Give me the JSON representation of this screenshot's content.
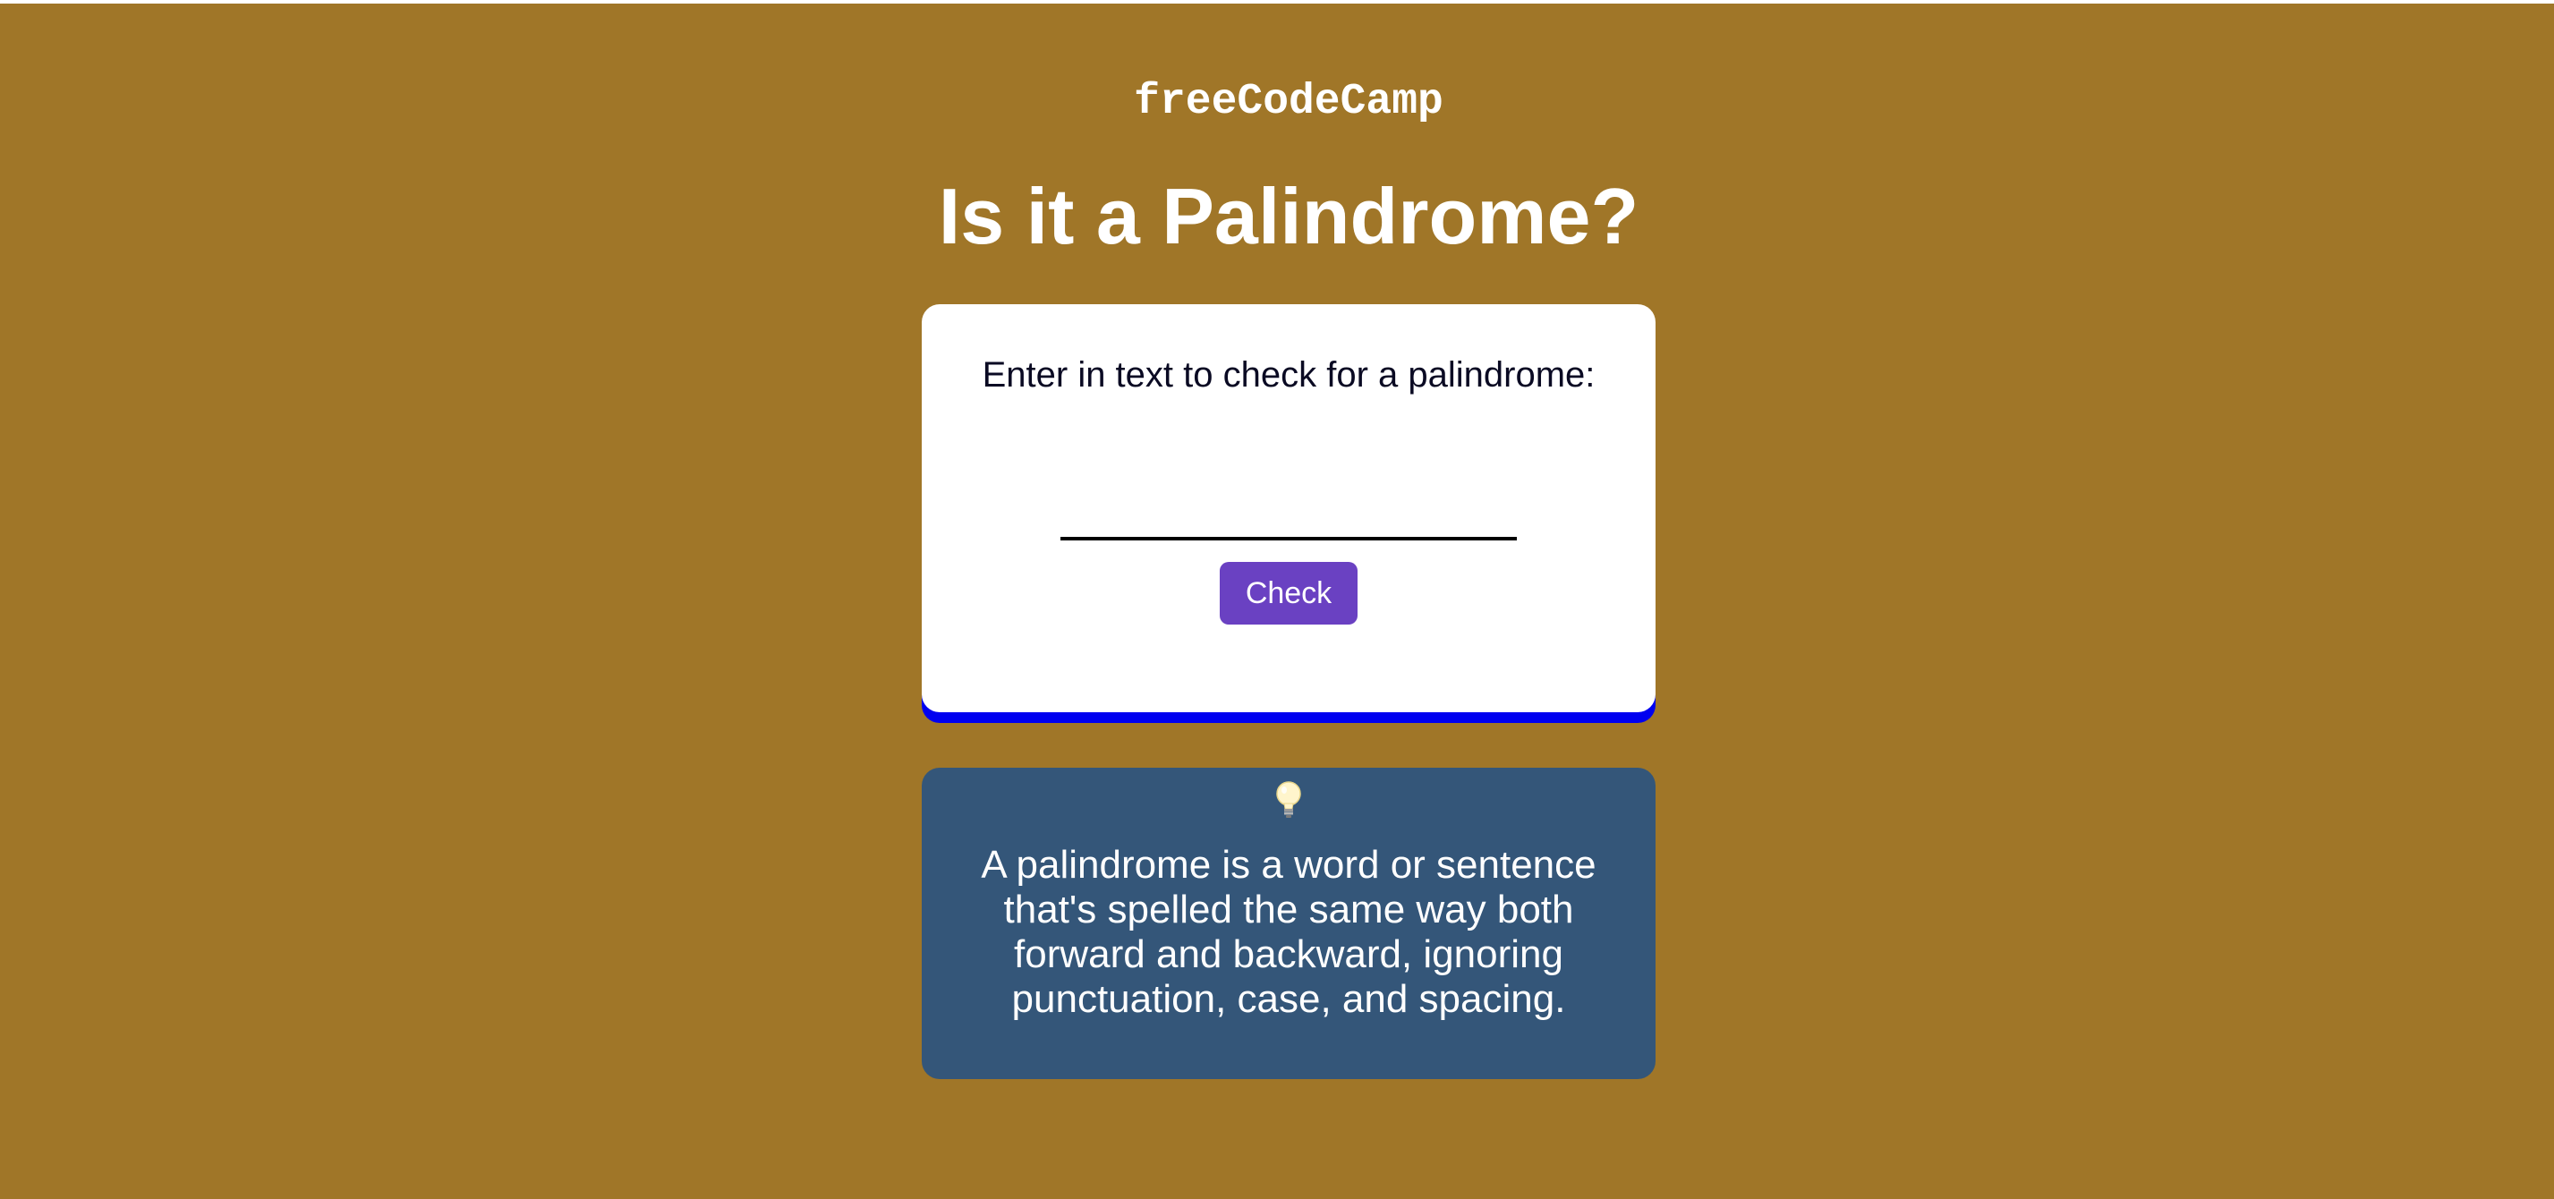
{
  "brand": {
    "text": "freeCodeCamp"
  },
  "page": {
    "title": "Is it a Palindrome?"
  },
  "card": {
    "label": "Enter in text to check for a palindrome:",
    "input_value": "",
    "input_placeholder": "",
    "check_label": "Check"
  },
  "info": {
    "icon": "lightbulb-icon",
    "text": "A palindrome is a word or sentence that's spelled the same way both forward and backward, ignoring punctuation, case, and spacing."
  },
  "colors": {
    "background": "#a07628",
    "card": "#ffffff",
    "card_shadow": "#0000f0",
    "button": "#6a41c2",
    "info_box": "#345679",
    "text_light": "#ffffff",
    "text_dark": "#0a0a23"
  }
}
